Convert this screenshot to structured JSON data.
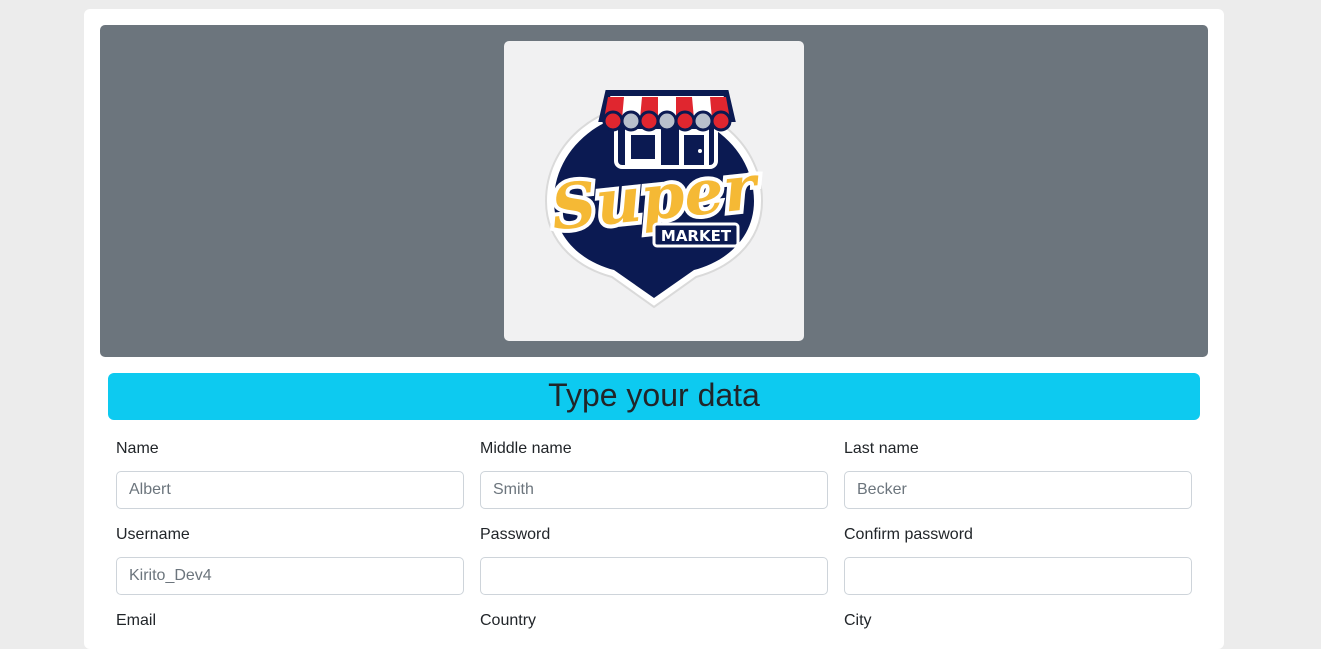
{
  "brand": {
    "logo_word": "Super",
    "logo_sub": "MARKET"
  },
  "form": {
    "title": "Type your data",
    "fields": {
      "name": {
        "label": "Name",
        "placeholder": "Albert"
      },
      "middle_name": {
        "label": "Middle name",
        "placeholder": "Smith"
      },
      "last_name": {
        "label": "Last name",
        "placeholder": "Becker"
      },
      "username": {
        "label": "Username",
        "placeholder": "Kirito_Dev4"
      },
      "password": {
        "label": "Password",
        "placeholder": ""
      },
      "confirm_password": {
        "label": "Confirm password",
        "placeholder": ""
      },
      "email": {
        "label": "Email"
      },
      "country": {
        "label": "Country"
      },
      "city": {
        "label": "City"
      }
    }
  },
  "colors": {
    "banner": "#6c757d",
    "heading_bg": "#0dcaf0",
    "logo_navy": "#0b1a52",
    "logo_gold": "#f5b935",
    "awning_red": "#e0262f"
  }
}
